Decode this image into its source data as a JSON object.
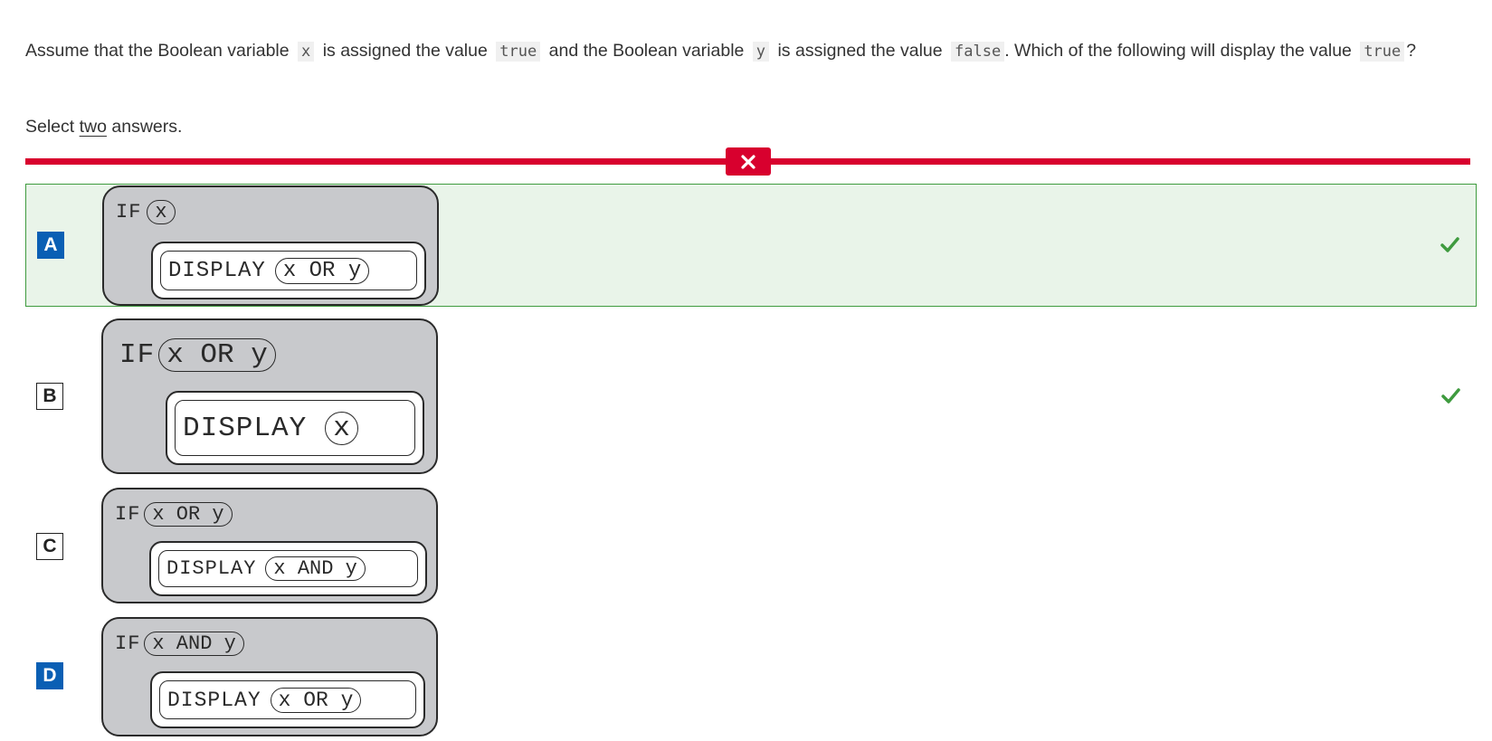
{
  "question": {
    "part1": "Assume that the Boolean variable",
    "code_x": "x",
    "part2": "is assigned the value",
    "code_true": "true",
    "part3": "and the Boolean variable",
    "code_y": "y",
    "part4": "is assigned the value",
    "code_false": "false",
    "part5": ". Which of the following will display the value",
    "code_true2": "true",
    "part6": "?"
  },
  "instruction": {
    "prefix": "Select",
    "emphasis": "two",
    "suffix": "answers."
  },
  "result": {
    "status": "incorrect",
    "badge_icon": "x-mark-icon",
    "color": "#d8002e"
  },
  "options": [
    {
      "letter": "A",
      "selected": true,
      "correct": true,
      "if_keyword": "IF",
      "condition": "x",
      "display_keyword": "DISPLAY",
      "display_arg": "x OR y"
    },
    {
      "letter": "B",
      "selected": false,
      "correct": true,
      "if_keyword": "IF",
      "condition": "x OR y",
      "display_keyword": "DISPLAY",
      "display_arg": "x"
    },
    {
      "letter": "C",
      "selected": false,
      "correct": false,
      "if_keyword": "IF",
      "condition": "x OR y",
      "display_keyword": "DISPLAY",
      "display_arg": "x AND y"
    },
    {
      "letter": "D",
      "selected": true,
      "correct": false,
      "if_keyword": "IF",
      "condition": "x AND y",
      "display_keyword": "DISPLAY",
      "display_arg": "x OR y"
    }
  ],
  "colors": {
    "selected_letter_bg": "#0a5fb4",
    "correct_check": "#3f9b3f",
    "correct_highlight_bg": "#e9f4e9",
    "block_bg": "#c8c9cc"
  }
}
